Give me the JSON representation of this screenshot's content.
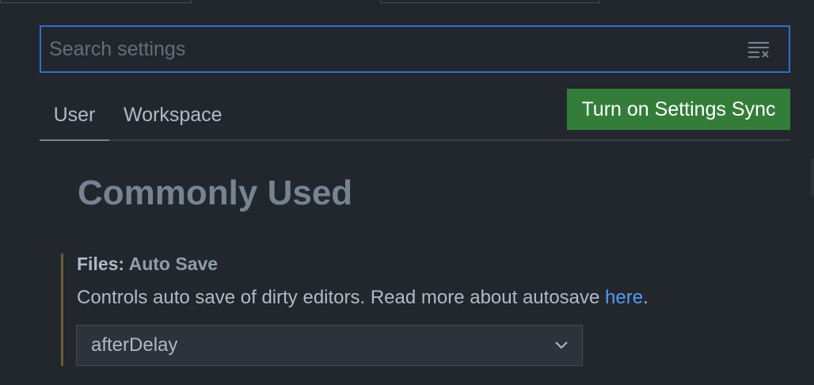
{
  "search": {
    "placeholder": "Search settings",
    "value": "",
    "clear_icon": "clear-filter-icon"
  },
  "tabs": [
    {
      "label": "User",
      "active": true
    },
    {
      "label": "Workspace",
      "active": false
    }
  ],
  "sync_button": {
    "label": "Turn on Settings Sync",
    "color": "#347d39"
  },
  "section": {
    "title": "Commonly Used"
  },
  "setting": {
    "category": "Files: ",
    "name": "Auto Save",
    "description": "Controls auto save of dirty editors. Read more about autosave ",
    "link_text": "here",
    "description_end": ".",
    "selected_value": "afterDelay",
    "dropdown_icon": "chevron-down-icon",
    "modified_color": "#6c5d2f"
  },
  "colors": {
    "background": "#22272e",
    "focus_border": "#316dca",
    "link": "#539bf5"
  }
}
